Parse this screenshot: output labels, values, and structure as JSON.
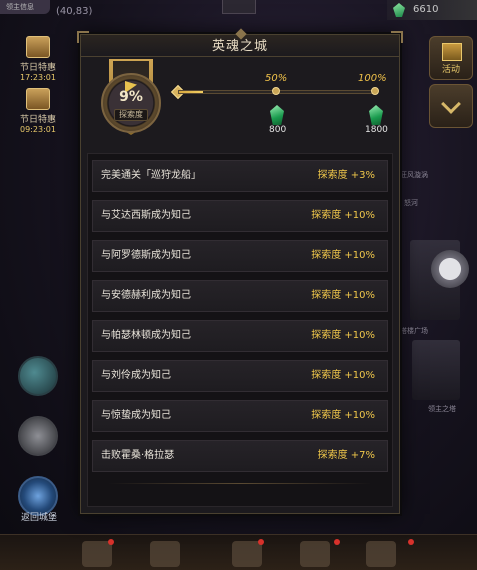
{
  "hud": {
    "top_left_label": "领主信息",
    "coordinates": "(40,83)",
    "currency_amount": "6610"
  },
  "side_events": [
    {
      "name": "节日特惠",
      "time": "17:23:01"
    },
    {
      "name": "节日特惠",
      "time": "09:23:01"
    }
  ],
  "side_icons": {
    "portal_label": "返回城堡"
  },
  "right_buttons": {
    "activity_label": "活动"
  },
  "bg_labels": {
    "a": "塔楼广场",
    "b": "领主之塔",
    "c": "狂风漩涡",
    "d": "怒河"
  },
  "modal": {
    "title": "英魂之城",
    "exploration": {
      "percent_text": "9%",
      "label": "探索度",
      "progress": 0.09
    },
    "milestones": [
      {
        "pct_label": "50%",
        "reward": "800",
        "position": 0.5
      },
      {
        "pct_label": "100%",
        "reward": "1800",
        "position": 1.0
      }
    ],
    "tasks": [
      {
        "name": "完美通关「巡狩龙船」",
        "reward": "探索度 +3%"
      },
      {
        "name": "与艾达西斯成为知己",
        "reward": "探索度 +10%"
      },
      {
        "name": "与阿罗德斯成为知己",
        "reward": "探索度 +10%"
      },
      {
        "name": "与安德赫利成为知己",
        "reward": "探索度 +10%"
      },
      {
        "name": "与帕瑟林顿成为知己",
        "reward": "探索度 +10%"
      },
      {
        "name": "与刘伶成为知己",
        "reward": "探索度 +10%"
      },
      {
        "name": "与惊蛰成为知己",
        "reward": "探索度 +10%"
      },
      {
        "name": "击败霍桑·格拉瑟",
        "reward": "探索度 +7%"
      }
    ]
  },
  "colors": {
    "accent_gold": "#f1c84a",
    "reward_gem": "#1a9b4e",
    "panel_bg": "#1c1a1e"
  },
  "icons": {
    "currency": "green-gem-icon",
    "reward": "green-gem-icon",
    "event": "treasure-chest-icon"
  }
}
